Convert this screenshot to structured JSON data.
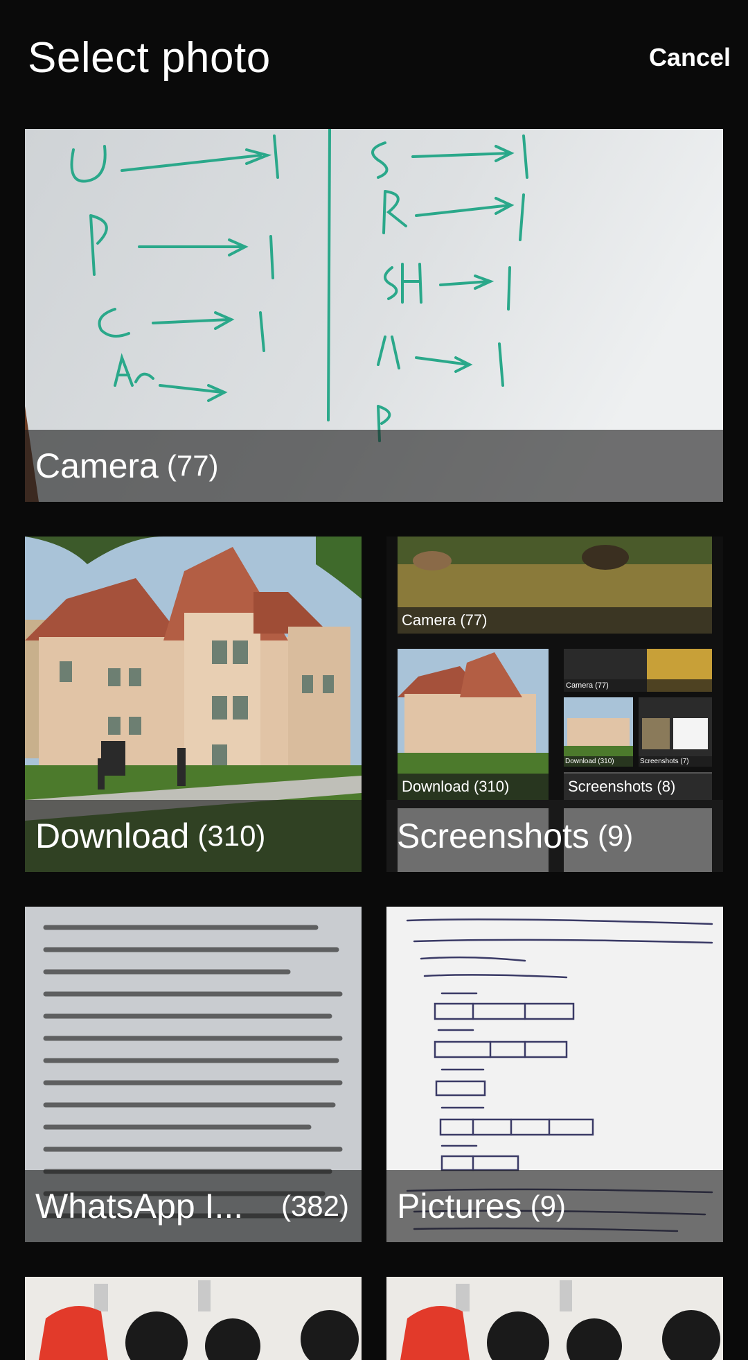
{
  "header": {
    "title": "Select photo",
    "cancel_label": "Cancel"
  },
  "albums": [
    {
      "name": "Camera",
      "count": "(77)"
    },
    {
      "name": "Download",
      "count": "(310)"
    },
    {
      "name": "Screenshots",
      "count": "(9)"
    },
    {
      "name": "WhatsApp I...",
      "count": "(382)"
    },
    {
      "name": "Pictures",
      "count": "(9)"
    }
  ],
  "collage": {
    "camera": "Camera (77)",
    "download": "Download (310)",
    "screenshots": "Screenshots (8)",
    "tiny_camera": "Camera (77)",
    "tiny_download": "Download (310)",
    "tiny_screenshots": "Screenshots (7)"
  }
}
